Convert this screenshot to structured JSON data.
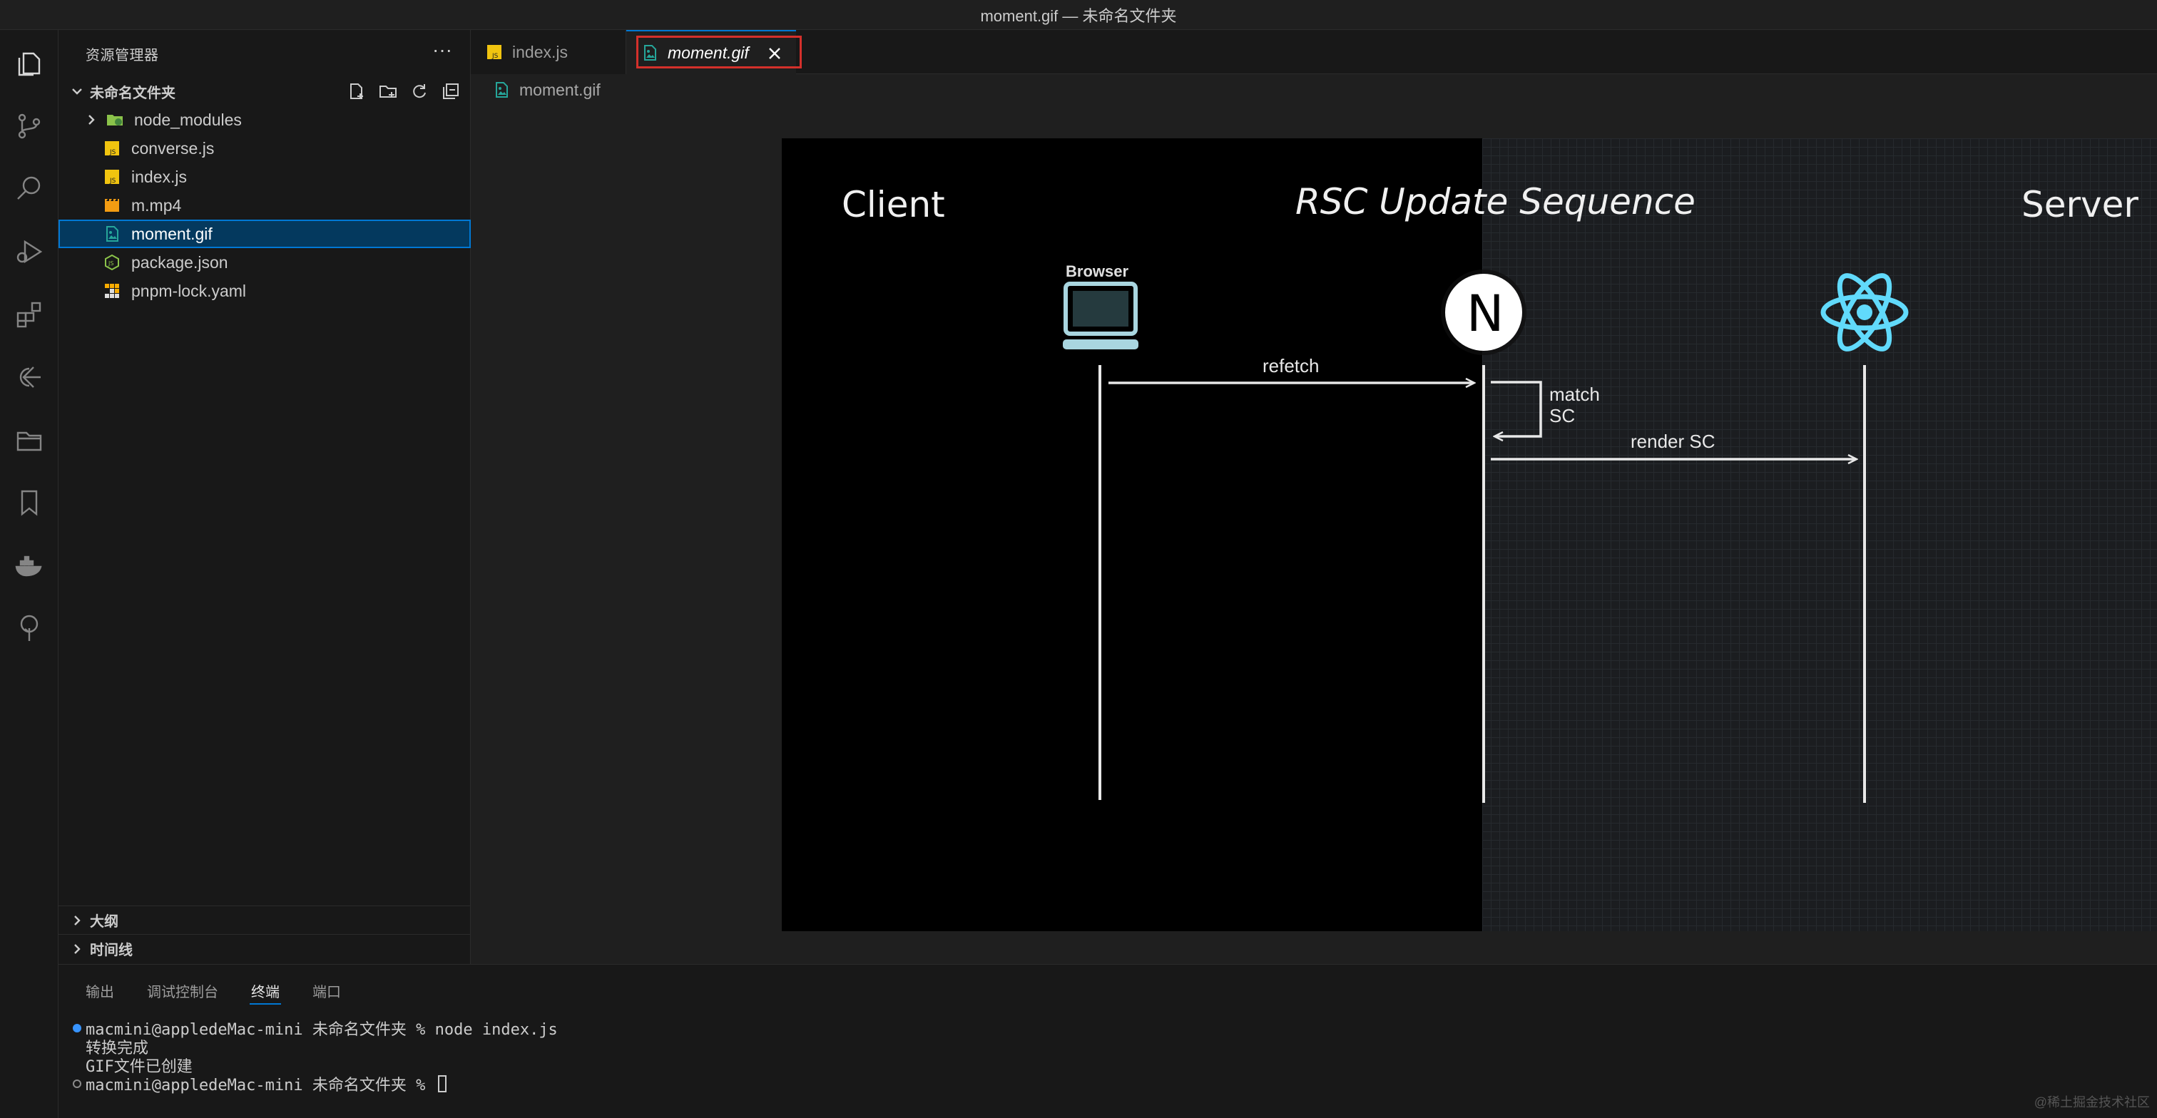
{
  "window": {
    "title": "moment.gif — 未命名文件夹"
  },
  "activity_bar": {
    "items": [
      "explorer-icon",
      "source-control-icon",
      "search-icon",
      "run-debug-icon",
      "extensions-icon",
      "remote-icon",
      "folder-icon",
      "bookmark-icon",
      "docker-icon",
      "tree-icon"
    ]
  },
  "explorer": {
    "title": "资源管理器",
    "more": "···",
    "folder_name": "未命名文件夹",
    "files": [
      {
        "name": "node_modules",
        "kind": "folder"
      },
      {
        "name": "converse.js",
        "kind": "js"
      },
      {
        "name": "index.js",
        "kind": "js"
      },
      {
        "name": "m.mp4",
        "kind": "video"
      },
      {
        "name": "moment.gif",
        "kind": "image",
        "selected": true
      },
      {
        "name": "package.json",
        "kind": "json"
      },
      {
        "name": "pnpm-lock.yaml",
        "kind": "yaml"
      }
    ],
    "outline_label": "大纲",
    "timeline_label": "时间线"
  },
  "tabs": [
    {
      "label": "index.js",
      "active": false
    },
    {
      "label": "moment.gif",
      "active": true
    }
  ],
  "breadcrumb": {
    "file": "moment.gif"
  },
  "gif": {
    "client_label": "Client",
    "title": "RSC Update Sequence",
    "server_label": "Server",
    "browser_label": "Browser",
    "next_glyph": "N",
    "refetch_label": "refetch",
    "match_label_1": "match",
    "match_label_2": "SC",
    "render_label": "render SC"
  },
  "panel": {
    "tabs": [
      "输出",
      "调试控制台",
      "终端",
      "端口"
    ],
    "active_tab": "终端",
    "terminal": {
      "line1": "macmini@appledeMac-mini 未命名文件夹 % node index.js",
      "line2": "转换完成",
      "line3": "GIF文件已创建",
      "line4": "macmini@appledeMac-mini 未命名文件夹 % "
    }
  },
  "watermark": "@稀土掘金技术社区",
  "colors": {
    "accent": "#0078d4",
    "highlight_box": "#d4302b",
    "react_blue": "#61dafb"
  }
}
